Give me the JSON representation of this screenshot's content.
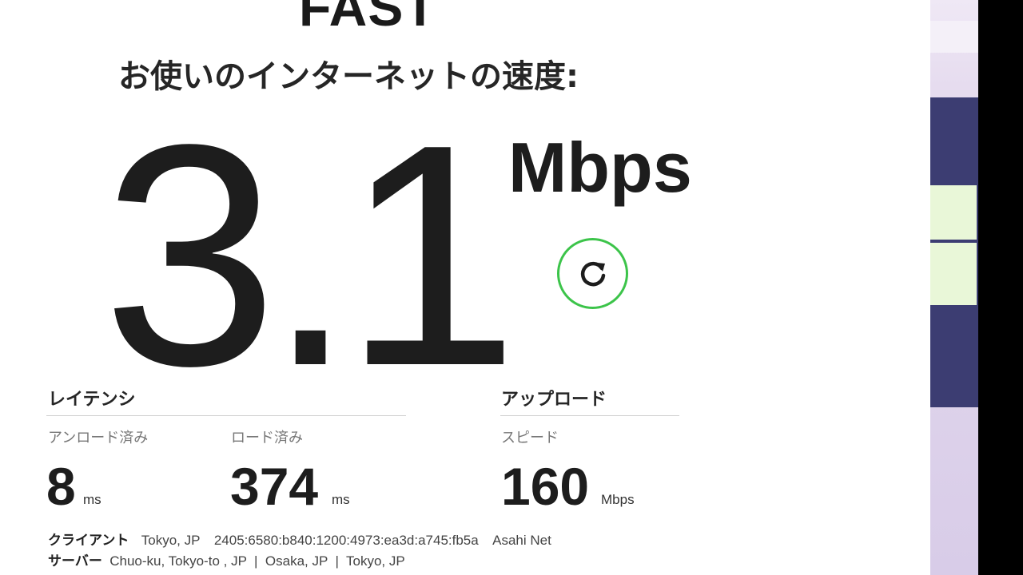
{
  "logo": "FAST",
  "heading": "お使いのインターネットの速度:",
  "speed": {
    "value": "3.1",
    "unit": "Mbps"
  },
  "refresh": {
    "icon": "refresh-icon",
    "accent": "#3cc44a"
  },
  "latency": {
    "title": "レイテンシ",
    "unloaded": {
      "label": "アンロード済み",
      "value": "8",
      "unit": "ms"
    },
    "loaded": {
      "label": "ロード済み",
      "value": "374",
      "unit": "ms"
    }
  },
  "upload": {
    "title": "アップロード",
    "speed": {
      "label": "スピード",
      "value": "160",
      "unit": "Mbps"
    }
  },
  "client": {
    "key": "クライアント",
    "location": "Tokyo, JP",
    "ip": "2405:6580:b840:1200:4973:ea3d:a745:fb5a",
    "isp": "Asahi Net"
  },
  "server": {
    "key": "サーバー",
    "locations": "Chuo-ku, Tokyo-to , JP  |  Osaka, JP  |  Tokyo, JP"
  }
}
